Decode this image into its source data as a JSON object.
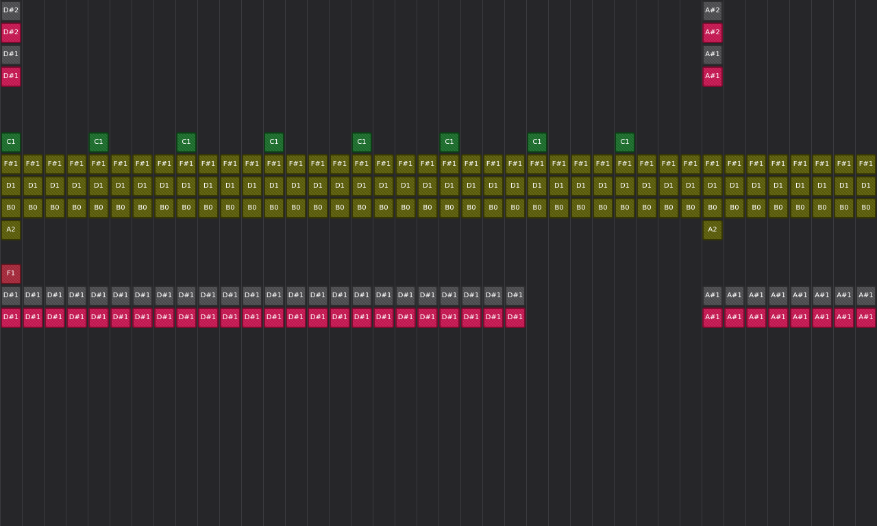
{
  "colors": {
    "background": "#262629",
    "gridline": "#3b3b3f",
    "gray": "#4d4d50",
    "pink": "#cc1653",
    "green": "#1a6f2b",
    "olive": "#5c5e08",
    "red": "#a9283a"
  },
  "tracks": [
    {
      "id": "ds2-gray",
      "notes": [
        {
          "label": "D#2",
          "color": "gray",
          "cols": [
            0
          ]
        },
        {
          "label": "A#2",
          "color": "gray",
          "cols": [
            32
          ]
        }
      ]
    },
    {
      "id": "ds2-pink",
      "notes": [
        {
          "label": "D#2",
          "color": "pink",
          "cols": [
            0
          ]
        },
        {
          "label": "A#2",
          "color": "pink",
          "cols": [
            32
          ]
        }
      ]
    },
    {
      "id": "ds1-gray",
      "notes": [
        {
          "label": "D#1",
          "color": "gray",
          "cols": [
            0
          ]
        },
        {
          "label": "A#1",
          "color": "gray",
          "cols": [
            32
          ]
        }
      ]
    },
    {
      "id": "ds1-pink",
      "notes": [
        {
          "label": "D#1",
          "color": "pink",
          "cols": [
            0
          ]
        },
        {
          "label": "A#1",
          "color": "pink",
          "cols": [
            32
          ]
        }
      ]
    },
    {
      "id": "empty-1",
      "notes": []
    },
    {
      "id": "empty-2",
      "notes": []
    },
    {
      "id": "c1-green",
      "notes": [
        {
          "label": "C1",
          "color": "green",
          "cols": [
            0,
            4,
            8,
            12,
            16,
            20,
            24,
            28
          ]
        }
      ]
    },
    {
      "id": "fs1-olive",
      "notes": [
        {
          "label": "F#1",
          "color": "olive",
          "cols": [
            0,
            1,
            2,
            3,
            4,
            5,
            6,
            7,
            8,
            9,
            10,
            11,
            12,
            13,
            14,
            15,
            16,
            17,
            18,
            19,
            20,
            21,
            22,
            23,
            24,
            25,
            26,
            27,
            28,
            29,
            30,
            31,
            32,
            33,
            34,
            35,
            36,
            37,
            38,
            39
          ]
        }
      ]
    },
    {
      "id": "d1-olive",
      "notes": [
        {
          "label": "D1",
          "color": "olive",
          "cols": [
            0,
            1,
            2,
            3,
            4,
            5,
            6,
            7,
            8,
            9,
            10,
            11,
            12,
            13,
            14,
            15,
            16,
            17,
            18,
            19,
            20,
            21,
            22,
            23,
            24,
            25,
            26,
            27,
            28,
            29,
            30,
            31,
            32,
            33,
            34,
            35,
            36,
            37,
            38,
            39
          ]
        }
      ]
    },
    {
      "id": "b0-olive",
      "notes": [
        {
          "label": "B0",
          "color": "olive",
          "cols": [
            0,
            1,
            2,
            3,
            4,
            5,
            6,
            7,
            8,
            9,
            10,
            11,
            12,
            13,
            14,
            15,
            16,
            17,
            18,
            19,
            20,
            21,
            22,
            23,
            24,
            25,
            26,
            27,
            28,
            29,
            30,
            31,
            32,
            33,
            34,
            35,
            36,
            37,
            38,
            39
          ]
        }
      ]
    },
    {
      "id": "a2-olive",
      "notes": [
        {
          "label": "A2",
          "color": "olive",
          "cols": [
            0,
            32
          ]
        }
      ]
    },
    {
      "id": "empty-3",
      "notes": []
    },
    {
      "id": "f1-red",
      "notes": [
        {
          "label": "F1",
          "color": "red",
          "cols": [
            0
          ]
        }
      ]
    },
    {
      "id": "low-gray",
      "notes": [
        {
          "label": "D#1",
          "color": "gray",
          "cols": [
            0,
            1,
            2,
            3,
            4,
            5,
            6,
            7,
            8,
            9,
            10,
            11,
            12,
            13,
            14,
            15,
            16,
            17,
            18,
            19,
            20,
            21,
            22,
            23
          ]
        },
        {
          "label": "A#1",
          "color": "gray",
          "cols": [
            32,
            33,
            34,
            35,
            36,
            37,
            38,
            39
          ]
        }
      ]
    },
    {
      "id": "low-pink",
      "notes": [
        {
          "label": "D#1",
          "color": "pink",
          "cols": [
            0,
            1,
            2,
            3,
            4,
            5,
            6,
            7,
            8,
            9,
            10,
            11,
            12,
            13,
            14,
            15,
            16,
            17,
            18,
            19,
            20,
            21,
            22,
            23
          ]
        },
        {
          "label": "A#1",
          "color": "pink",
          "cols": [
            32,
            33,
            34,
            35,
            36,
            37,
            38,
            39
          ]
        }
      ]
    }
  ]
}
